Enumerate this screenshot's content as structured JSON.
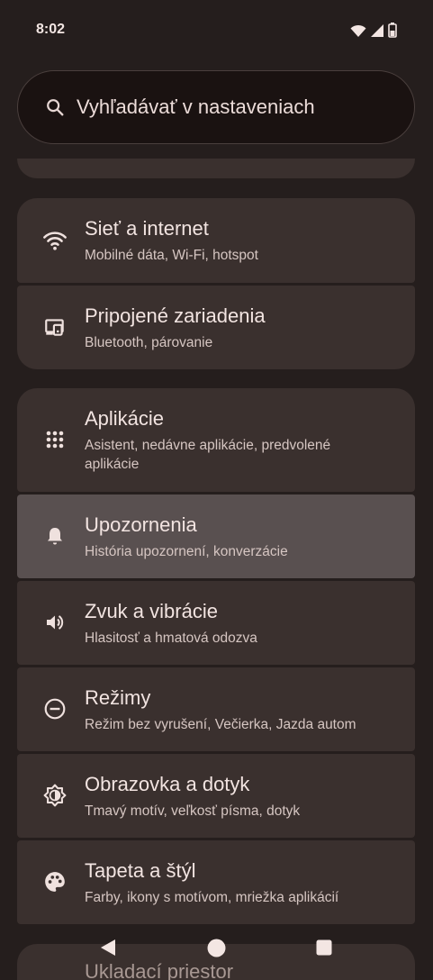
{
  "status": {
    "time": "8:02"
  },
  "search": {
    "placeholder": "Vyhľadávať v nastaveniach"
  },
  "settings": {
    "group1": [
      {
        "title": "Sieť a internet",
        "subtitle": "Mobilné dáta, Wi-Fi, hotspot",
        "icon": "wifi-icon"
      },
      {
        "title": "Pripojené zariadenia",
        "subtitle": "Bluetooth, párovanie",
        "icon": "connected-devices-icon"
      }
    ],
    "group2": [
      {
        "title": "Aplikácie",
        "subtitle": "Asistent, nedávne aplikácie, predvolené aplikácie",
        "icon": "apps-icon"
      },
      {
        "title": "Upozornenia",
        "subtitle": "História upozornení, konverzácie",
        "icon": "bell-icon"
      },
      {
        "title": "Zvuk a vibrácie",
        "subtitle": "Hlasitosť a hmatová odozva",
        "icon": "volume-icon"
      },
      {
        "title": "Režimy",
        "subtitle": "Režim bez vyrušení, Večierka, Jazda autom",
        "icon": "do-not-disturb-icon"
      },
      {
        "title": "Obrazovka a dotyk",
        "subtitle": "Tmavý motív, veľkosť písma, dotyk",
        "icon": "display-brightness-icon"
      },
      {
        "title": "Tapeta a štýl",
        "subtitle": "Farby, ikony s motívom, mriežka aplikácií",
        "icon": "palette-icon"
      }
    ],
    "partial_next": "Ukladací priestor"
  },
  "colors": {
    "background": "#251e1d",
    "card": "#3a302e",
    "highlight": "#595050"
  }
}
